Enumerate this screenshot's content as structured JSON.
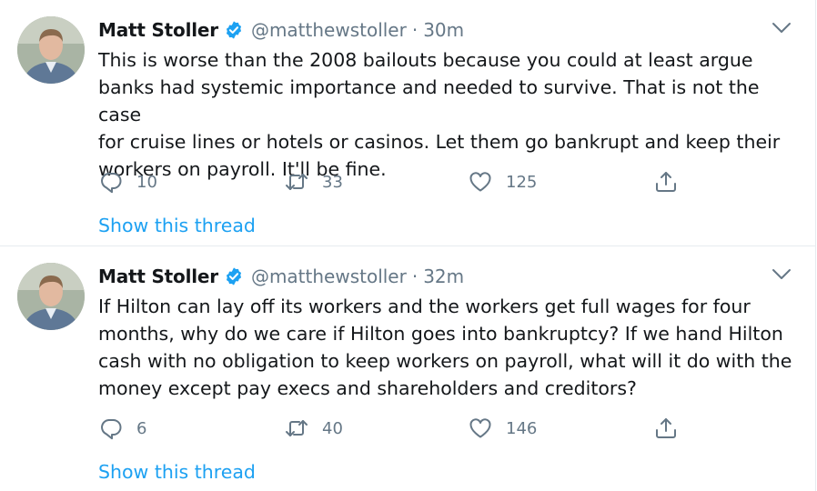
{
  "tweets": [
    {
      "author_name": "Matt Stoller",
      "handle": "@matthewstoller",
      "separator": "·",
      "time": "30m",
      "lines": [
        "This is worse than the 2008 bailouts because you could at least argue",
        "banks had systemic importance and needed to survive. That is not the case",
        "for cruise lines or hotels or casinos. Let them go bankrupt and keep their",
        "workers on payroll. It'll be fine."
      ],
      "replies": "10",
      "retweets": "33",
      "likes": "125",
      "show_thread": "Show this thread"
    },
    {
      "author_name": "Matt Stoller",
      "handle": "@matthewstoller",
      "separator": "·",
      "time": "32m",
      "lines": [
        "If Hilton can lay off its workers and the workers get full wages for four",
        "months, why do we care if Hilton goes into bankruptcy? If we hand Hilton",
        "cash with no obligation to keep workers on payroll, what will it do with the",
        "money except pay execs and shareholders and creditors?"
      ],
      "replies": "6",
      "retweets": "40",
      "likes": "146",
      "show_thread": "Show this thread"
    }
  ],
  "colors": {
    "text": "#14171a",
    "secondary": "#657786",
    "accent": "#1da1f2",
    "divider": "#e6ecf0"
  },
  "icons": [
    "verified-badge-icon",
    "chevron-down-icon",
    "reply-icon",
    "retweet-icon",
    "like-icon",
    "share-icon"
  ]
}
